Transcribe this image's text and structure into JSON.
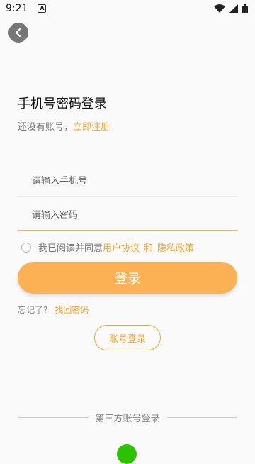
{
  "status": {
    "time": "9:21",
    "notification_icon": "A"
  },
  "header": {
    "back_icon": "chevron-left-icon"
  },
  "form": {
    "title": "手机号密码登录",
    "no_account_text": "还没有账号，",
    "register_link": "立即注册",
    "phone_placeholder": "请输入手机号",
    "password_placeholder": "请输入密码",
    "agreement_prefix": "我已阅读并同意",
    "user_agreement": "用户协议",
    "and_text": "和",
    "privacy_policy": "隐私政策",
    "login_button": "登录",
    "forgot_text": "忘记了?",
    "recover_password": "找回密码",
    "account_login_button": "账号登录",
    "third_party_label": "第三方账号登录"
  },
  "colors": {
    "accent": "#f7a534",
    "button": "#fbb154",
    "wechat": "#2dc100"
  }
}
